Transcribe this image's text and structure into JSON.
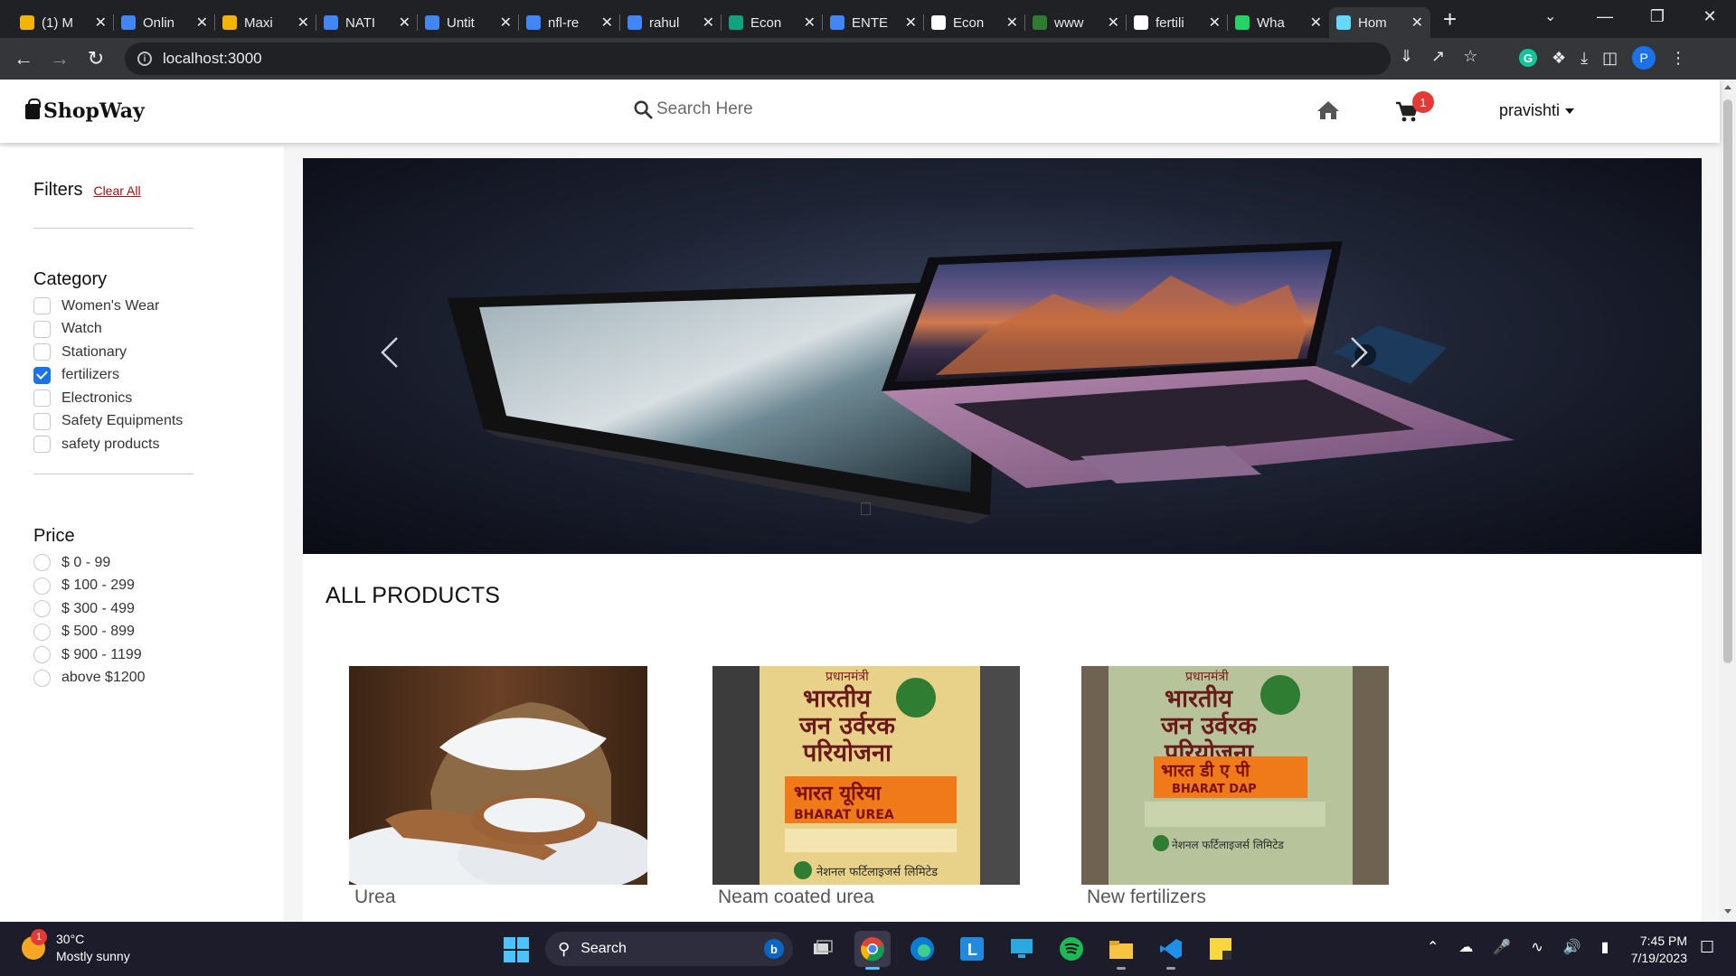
{
  "browser": {
    "tabs": [
      {
        "title": "(1) M",
        "icon": "flash-icon",
        "color": "#f4b400"
      },
      {
        "title": "Onlin",
        "icon": "docs-icon",
        "color": "#4285f4"
      },
      {
        "title": "Maxi",
        "icon": "flash-icon",
        "color": "#f4b400"
      },
      {
        "title": "NATI",
        "icon": "docs-icon",
        "color": "#4285f4"
      },
      {
        "title": "Untit",
        "icon": "docs-icon",
        "color": "#4285f4"
      },
      {
        "title": "nfl-re",
        "icon": "docs-icon",
        "color": "#4285f4"
      },
      {
        "title": "rahul",
        "icon": "docs-icon",
        "color": "#4285f4"
      },
      {
        "title": "Econ",
        "icon": "chatgpt-icon",
        "color": "#10a37f"
      },
      {
        "title": "ENTE",
        "icon": "docs-icon",
        "color": "#4285f4"
      },
      {
        "title": "Econ",
        "icon": "chatgpt-icon",
        "color": "#ffffff"
      },
      {
        "title": "www",
        "icon": "leaf-icon",
        "color": "#2e7d32"
      },
      {
        "title": "fertili",
        "icon": "google-icon",
        "color": "#ffffff"
      },
      {
        "title": "Wha",
        "icon": "whatsapp-icon",
        "color": "#25d366"
      },
      {
        "title": "Hom",
        "icon": "react-icon",
        "color": "#61dafb"
      }
    ],
    "active_tab": 13,
    "url": "localhost:3000"
  },
  "navbar": {
    "brand": "ShopWay",
    "search_placeholder": "Search Here",
    "cart_count": "1",
    "username": "pravishti"
  },
  "sidebar": {
    "filters_title": "Filters",
    "clear_all": "Clear All",
    "category_title": "Category",
    "categories": [
      {
        "label": "Women's Wear",
        "checked": false
      },
      {
        "label": "Watch",
        "checked": false
      },
      {
        "label": "Stationary",
        "checked": false
      },
      {
        "label": "fertilizers",
        "checked": true
      },
      {
        "label": "Electronics",
        "checked": false
      },
      {
        "label": "Safety Equipments",
        "checked": false
      },
      {
        "label": "safety products",
        "checked": false
      }
    ],
    "price_title": "Price",
    "prices": [
      "$ 0 - 99",
      "$ 100 - 299",
      "$ 300 - 499",
      "$ 500 - 899",
      "$ 900 - 1199",
      "above $1200"
    ]
  },
  "main": {
    "section_heading": "ALL PRODUCTS",
    "products": [
      {
        "name": "Urea"
      },
      {
        "name": "Neam coated urea"
      },
      {
        "name": "New fertilizers"
      }
    ]
  },
  "bag_labels": {
    "scheme_top": "प्रधानमंत्री",
    "scheme_l1": "भारतीय",
    "scheme_l2": "जन उर्वरक",
    "scheme_l3": "परियोजना",
    "urea_hindi": "भारत यूरिया",
    "urea_en": "BHARAT UREA",
    "dap_hindi": "भारत डी ए पी",
    "dap_en": "BHARAT DAP",
    "maker": "नेशनल फर्टिलाइजर्स लिमिटेड"
  },
  "taskbar": {
    "temperature": "30°C",
    "weather": "Mostly sunny",
    "weather_badge": "1",
    "search_label": "Search",
    "time": "7:45 PM",
    "date": "7/19/2023"
  }
}
